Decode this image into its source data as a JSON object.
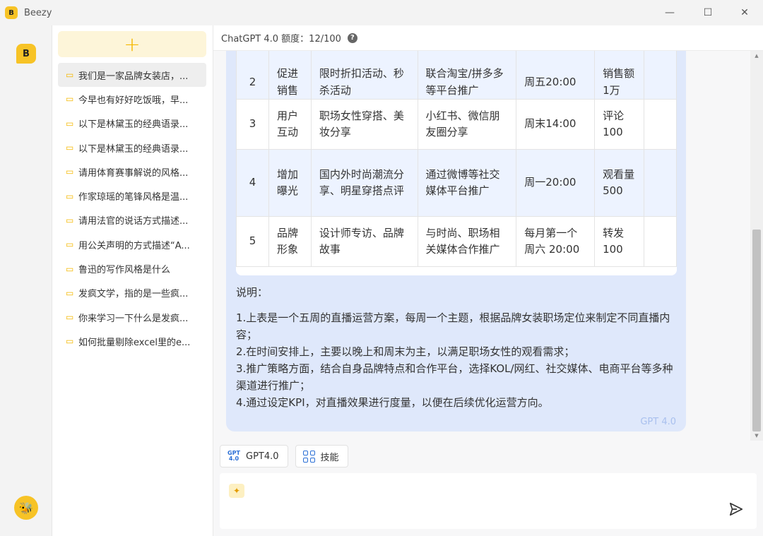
{
  "window": {
    "title": "Beezy",
    "logo_text": "B",
    "minimize": "—",
    "maximize": "☐",
    "close": "✕"
  },
  "rail": {
    "logo_text": "B",
    "avatar": "🐝"
  },
  "sidebar": {
    "new_chat_label": "+",
    "items": [
      {
        "label": "我们是一家品牌女装店，..."
      },
      {
        "label": "今早也有好好吃饭哦，早..."
      },
      {
        "label": "以下是林黛玉的经典语录..."
      },
      {
        "label": "以下是林黛玉的经典语录..."
      },
      {
        "label": "请用体育赛事解说的风格..."
      },
      {
        "label": "作家琼瑶的笔锋风格是温..."
      },
      {
        "label": "请用法官的说话方式描述..."
      },
      {
        "label": "用公关声明的方式描述“A..."
      },
      {
        "label": "鲁迅的写作风格是什么"
      },
      {
        "label": "发疯文学，指的是一些疯..."
      },
      {
        "label": "你来学习一下什么是发疯..."
      },
      {
        "label": "如何批量剔除excel里的e..."
      }
    ]
  },
  "header": {
    "quota_label": "ChatGPT 4.0 额度：12/100",
    "help_icon": "?"
  },
  "message": {
    "table": {
      "rows": [
        [
          "2",
          "促进销售",
          "限时折扣活动、秒杀活动",
          "联合淘宝/拼多多等平台推广",
          "周五20:00",
          "销售额1万",
          ""
        ],
        [
          "3",
          "用户互动",
          "职场女性穿搭、美妆分享",
          "小红书、微信朋友圈分享",
          "周末14:00",
          "评论100",
          ""
        ],
        [
          "4",
          "增加曝光",
          "国内外时尚潮流分享、明星穿搭点评",
          "通过微博等社交媒体平台推广",
          "周一20:00",
          "观看量500",
          ""
        ],
        [
          "5",
          "品牌形象",
          "设计师专访、品牌故事",
          "与时尚、职场相关媒体合作推广",
          "每月第一个周六 20:00",
          "转发100",
          ""
        ]
      ]
    },
    "notes_label": "说明：",
    "notes": [
      "1.上表是一个五周的直播运营方案，每周一个主题，根据品牌女装职场定位来制定不同直播内容；",
      "2.在时间安排上，主要以晚上和周末为主，以满足职场女性的观看需求；",
      "3.推广策略方面，结合自身品牌特点和合作平台，选择KOL/网红、社交媒体、电商平台等多种渠道进行推广；",
      "4.通过设定KPI，对直播效果进行度量，以便在后续优化运营方向。"
    ],
    "model_tag": "GPT 4.0"
  },
  "toolbar": {
    "gpt_icon_line1": "GPT",
    "gpt_icon_line2": "4.0",
    "gpt_label": "GPT4.0",
    "skills_label": "技能"
  },
  "input": {
    "value": "",
    "placeholder": "",
    "magic_icon": "✦"
  },
  "colors": {
    "brand": "#f7c326",
    "bubble": "#dfe8fb",
    "accent": "#2b6fd6"
  }
}
